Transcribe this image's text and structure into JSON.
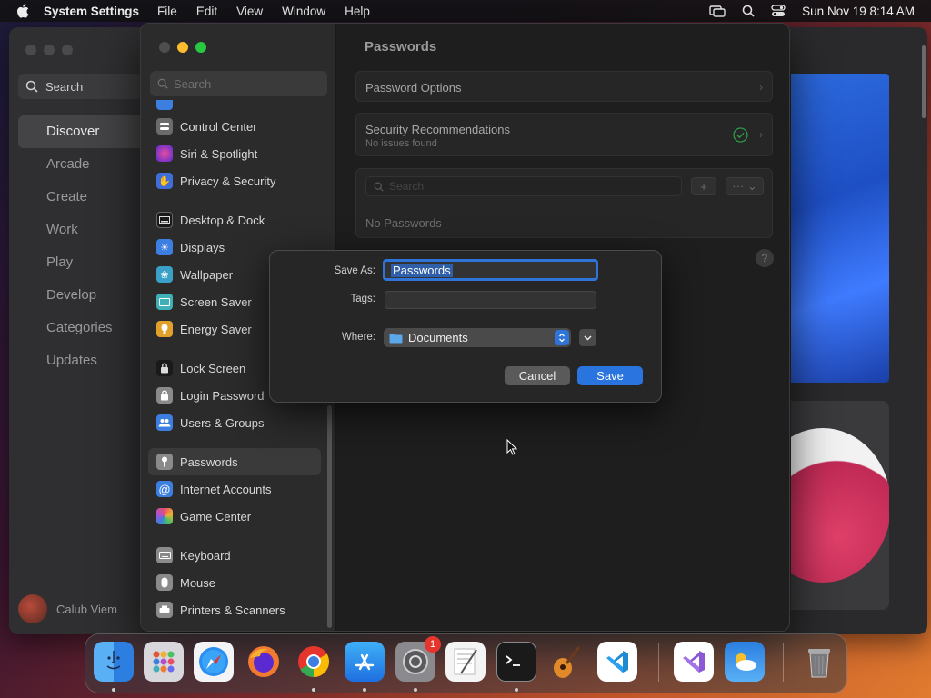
{
  "menubar": {
    "app_name": "System Settings",
    "menus": [
      "File",
      "Edit",
      "View",
      "Window",
      "Help"
    ],
    "clock": "Sun Nov 19  8:14 AM"
  },
  "appstore": {
    "search_placeholder": "Search",
    "nav": [
      "Discover",
      "Arcade",
      "Create",
      "Work",
      "Play",
      "Develop",
      "Categories",
      "Updates"
    ],
    "active_nav": "Discover",
    "user_name": "Calub Viem"
  },
  "settings": {
    "search_placeholder": "Search",
    "sidebar": [
      {
        "label": "Control Center",
        "icon": "control-center-icon",
        "color": "#6b6b6b"
      },
      {
        "label": "Siri & Spotlight",
        "icon": "siri-icon",
        "color": "#b0306e"
      },
      {
        "label": "Privacy & Security",
        "icon": "privacy-hand-icon",
        "color": "#3f6ed8"
      }
    ],
    "sidebar_group2": [
      {
        "label": "Desktop & Dock",
        "icon": "desktop-dock-icon",
        "color": "#2b2b2b"
      },
      {
        "label": "Displays",
        "icon": "displays-icon",
        "color": "#3d7fe0"
      },
      {
        "label": "Wallpaper",
        "icon": "wallpaper-icon",
        "color": "#3aa0c8"
      },
      {
        "label": "Screen Saver",
        "icon": "screen-saver-icon",
        "color": "#3fb0b8"
      },
      {
        "label": "Energy Saver",
        "icon": "energy-saver-icon",
        "color": "#e0a02a"
      }
    ],
    "sidebar_group3": [
      {
        "label": "Lock Screen",
        "icon": "lock-screen-icon",
        "color": "#2b2b2b"
      },
      {
        "label": "Login Password",
        "icon": "login-password-icon",
        "color": "#8a8a8a"
      },
      {
        "label": "Users & Groups",
        "icon": "users-groups-icon",
        "color": "#3d7fe0"
      }
    ],
    "sidebar_group4": [
      {
        "label": "Passwords",
        "icon": "key-icon",
        "color": "#8a8a8a"
      },
      {
        "label": "Internet Accounts",
        "icon": "at-icon",
        "color": "#3d7fe0"
      },
      {
        "label": "Game Center",
        "icon": "game-center-icon",
        "color": "#d04aa0"
      }
    ],
    "sidebar_group5": [
      {
        "label": "Keyboard",
        "icon": "keyboard-icon",
        "color": "#8a8a8a"
      },
      {
        "label": "Mouse",
        "icon": "mouse-icon",
        "color": "#8a8a8a"
      },
      {
        "label": "Printers & Scanners",
        "icon": "printer-icon",
        "color": "#8a8a8a"
      }
    ],
    "active_item": "Passwords",
    "main": {
      "title": "Passwords",
      "password_options": "Password Options",
      "security_title": "Security Recommendations",
      "security_sub": "No issues found",
      "search_placeholder": "Search",
      "empty_label": "No Passwords",
      "help": "?"
    }
  },
  "dialog": {
    "save_as_label": "Save As:",
    "save_as_value": "Passwords",
    "tags_label": "Tags:",
    "tags_value": "",
    "where_label": "Where:",
    "where_value": "Documents",
    "cancel": "Cancel",
    "save": "Save"
  },
  "dock": {
    "apps": [
      {
        "name": "finder-icon"
      },
      {
        "name": "launchpad-icon"
      },
      {
        "name": "safari-icon"
      },
      {
        "name": "firefox-icon"
      },
      {
        "name": "chrome-icon"
      },
      {
        "name": "app-store-icon"
      },
      {
        "name": "system-settings-icon",
        "badge": "1"
      },
      {
        "name": "textedit-icon"
      },
      {
        "name": "terminal-icon"
      },
      {
        "name": "garageband-icon"
      },
      {
        "name": "vscode-icon"
      },
      {
        "name": "visual-studio-icon"
      },
      {
        "name": "weather-icon"
      },
      {
        "name": "trash-icon"
      }
    ]
  },
  "colors": {
    "accent": "#2a74e0",
    "close": "#ff5f57",
    "minimize": "#febc2e",
    "zoom": "#28c840",
    "badge": "#e5352d"
  }
}
